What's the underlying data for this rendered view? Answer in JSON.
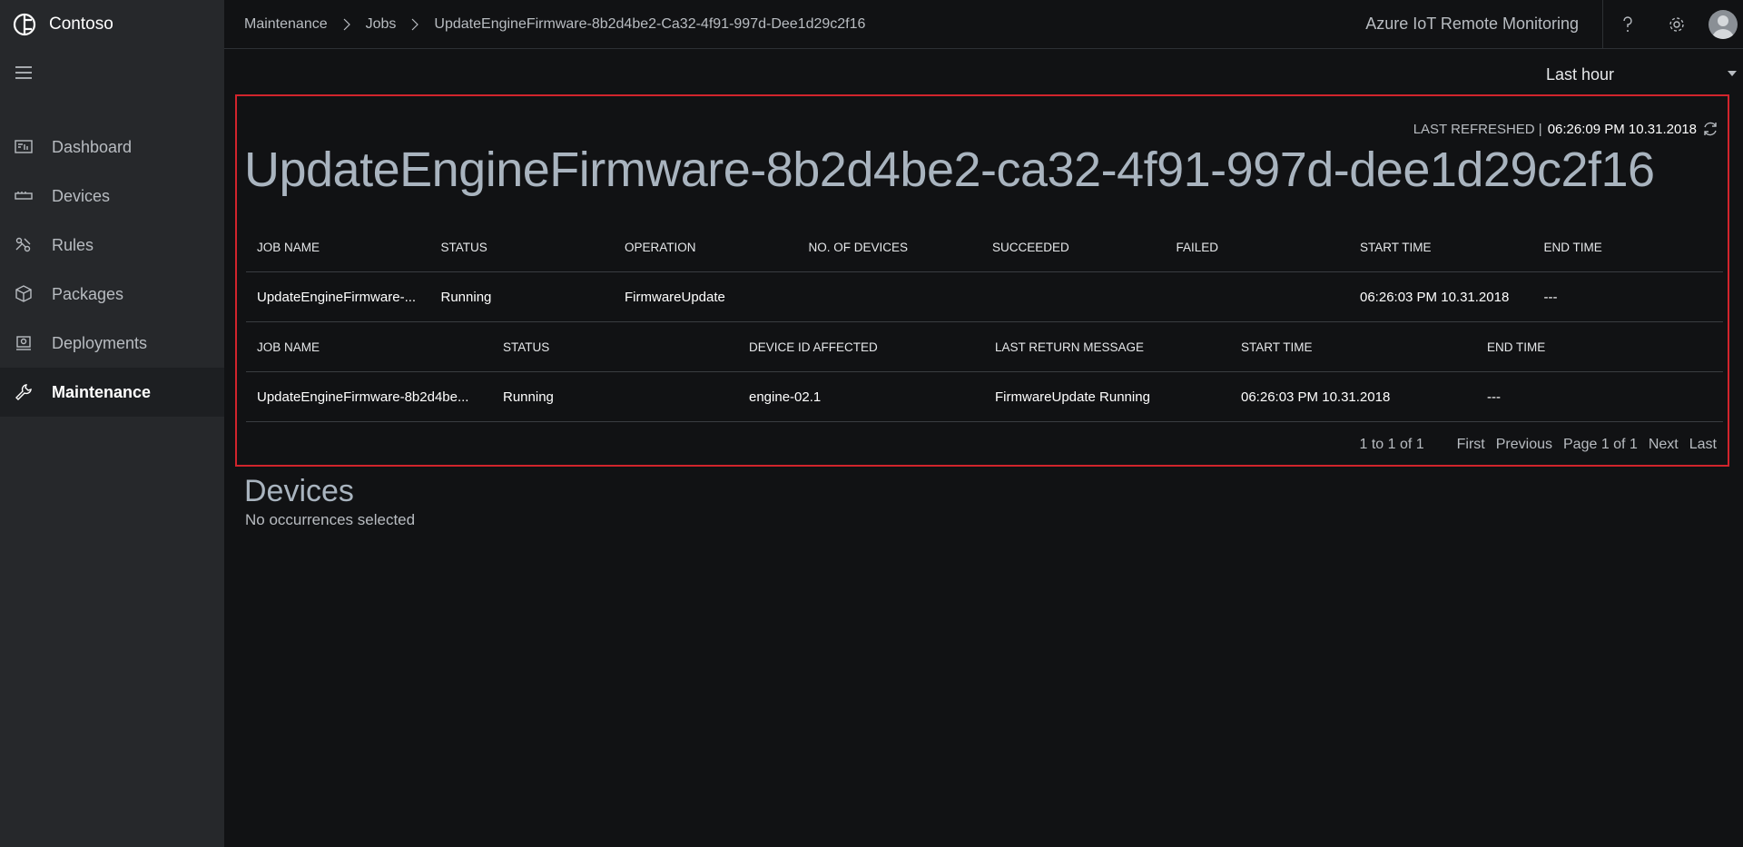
{
  "brand": {
    "name": "Contoso"
  },
  "sidebar": {
    "items": [
      {
        "label": "Dashboard",
        "icon": "dashboard-icon"
      },
      {
        "label": "Devices",
        "icon": "devices-icon"
      },
      {
        "label": "Rules",
        "icon": "rules-icon"
      },
      {
        "label": "Packages",
        "icon": "packages-icon"
      },
      {
        "label": "Deployments",
        "icon": "deployments-icon"
      },
      {
        "label": "Maintenance",
        "icon": "maintenance-icon",
        "active": true
      }
    ]
  },
  "header": {
    "breadcrumb": [
      "Maintenance",
      "Jobs",
      "UpdateEngineFirmware-8b2d4be2-Ca32-4f91-997d-Dee1d29c2f16"
    ],
    "app_title": "Azure IoT Remote Monitoring"
  },
  "timerange": {
    "selected": "Last hour"
  },
  "panel": {
    "last_refreshed_label": "LAST REFRESHED |",
    "last_refreshed_value": "06:26:09 PM 10.31.2018",
    "job_title": "UpdateEngineFirmware-8b2d4be2-ca32-4f91-997d-dee1d29c2f16",
    "jobs_table": {
      "headers": [
        "JOB NAME",
        "STATUS",
        "OPERATION",
        "NO. OF DEVICES",
        "SUCCEEDED",
        "FAILED",
        "START TIME",
        "END TIME"
      ],
      "rows": [
        [
          "UpdateEngineFirmware-...",
          "Running",
          "FirmwareUpdate",
          "",
          "",
          "",
          "06:26:03 PM 10.31.2018",
          "---"
        ]
      ]
    },
    "devices_table": {
      "headers": [
        "JOB NAME",
        "STATUS",
        "DEVICE ID AFFECTED",
        "LAST RETURN MESSAGE",
        "START TIME",
        "END TIME"
      ],
      "rows": [
        [
          "UpdateEngineFirmware-8b2d4be...",
          "Running",
          "engine-02.1",
          "FirmwareUpdate Running",
          "06:26:03 PM 10.31.2018",
          "---"
        ]
      ]
    },
    "pager": {
      "range": "1 to 1 of 1",
      "first": "First",
      "previous": "Previous",
      "page": "Page 1 of 1",
      "next": "Next",
      "last": "Last"
    }
  },
  "devices_section": {
    "title": "Devices",
    "empty_text": "No occurrences selected"
  },
  "colors": {
    "accent_border": "#d1242c",
    "sidebar_bg": "#26282b",
    "page_bg": "#111214"
  }
}
